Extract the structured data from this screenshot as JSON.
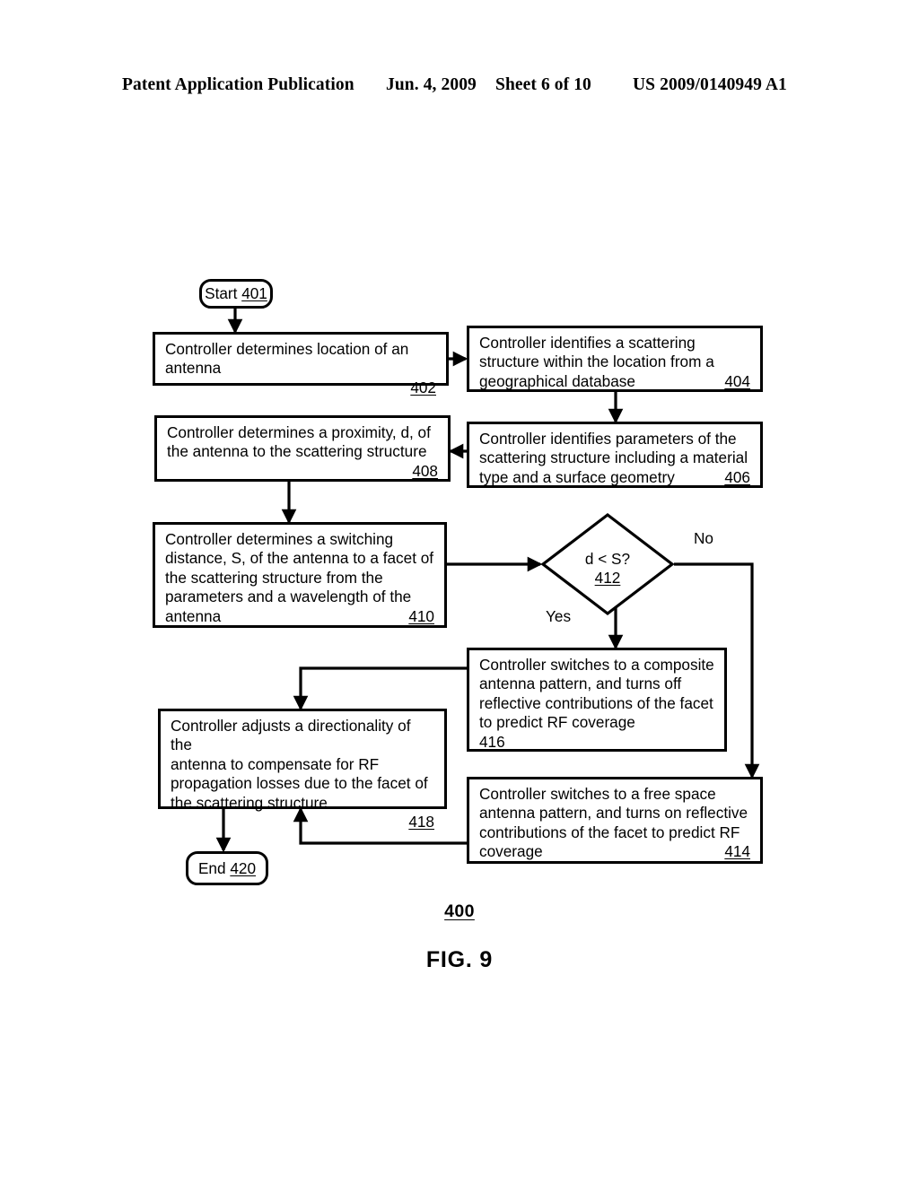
{
  "header": {
    "publication": "Patent Application Publication",
    "date": "Jun. 4, 2009",
    "sheet": "Sheet 6 of 10",
    "patent_number": "US 2009/0140949 A1"
  },
  "figure": {
    "number": "400",
    "title": "FIG. 9"
  },
  "flowchart": {
    "start": {
      "label": "Start",
      "ref": "401"
    },
    "end": {
      "label": "End",
      "ref": "420"
    },
    "decision": {
      "text": "d < S?",
      "ref": "412"
    },
    "branch_yes": "Yes",
    "branch_no": "No",
    "steps": [
      {
        "ref": "402",
        "text": "Controller determines location of an\nantenna"
      },
      {
        "ref": "404",
        "text": "Controller identifies a scattering\nstructure within the location from a\ngeographical database"
      },
      {
        "ref": "406",
        "text": "Controller identifies parameters of the\nscattering structure including a material\ntype and a surface geometry"
      },
      {
        "ref": "408",
        "text": "Controller determines a proximity, d, of\nthe antenna to the scattering structure"
      },
      {
        "ref": "410",
        "text": "Controller determines a switching\ndistance, S, of the antenna to a facet of\nthe scattering structure from the\nparameters and a wavelength of the\nantenna"
      },
      {
        "ref": "416",
        "text": "Controller switches to a composite\nantenna pattern, and turns off\nreflective contributions of the facet\nto predict RF coverage"
      },
      {
        "ref": "414",
        "text": "Controller switches to a free space\nantenna pattern, and turns on reflective\ncontributions of the facet to predict RF\ncoverage"
      },
      {
        "ref": "418",
        "text": "Controller adjusts a directionality of the\nantenna to compensate for RF\npropagation losses due to the facet of\nthe scattering structure"
      }
    ]
  },
  "colors": {
    "ink": "#000000",
    "paper": "#ffffff"
  }
}
